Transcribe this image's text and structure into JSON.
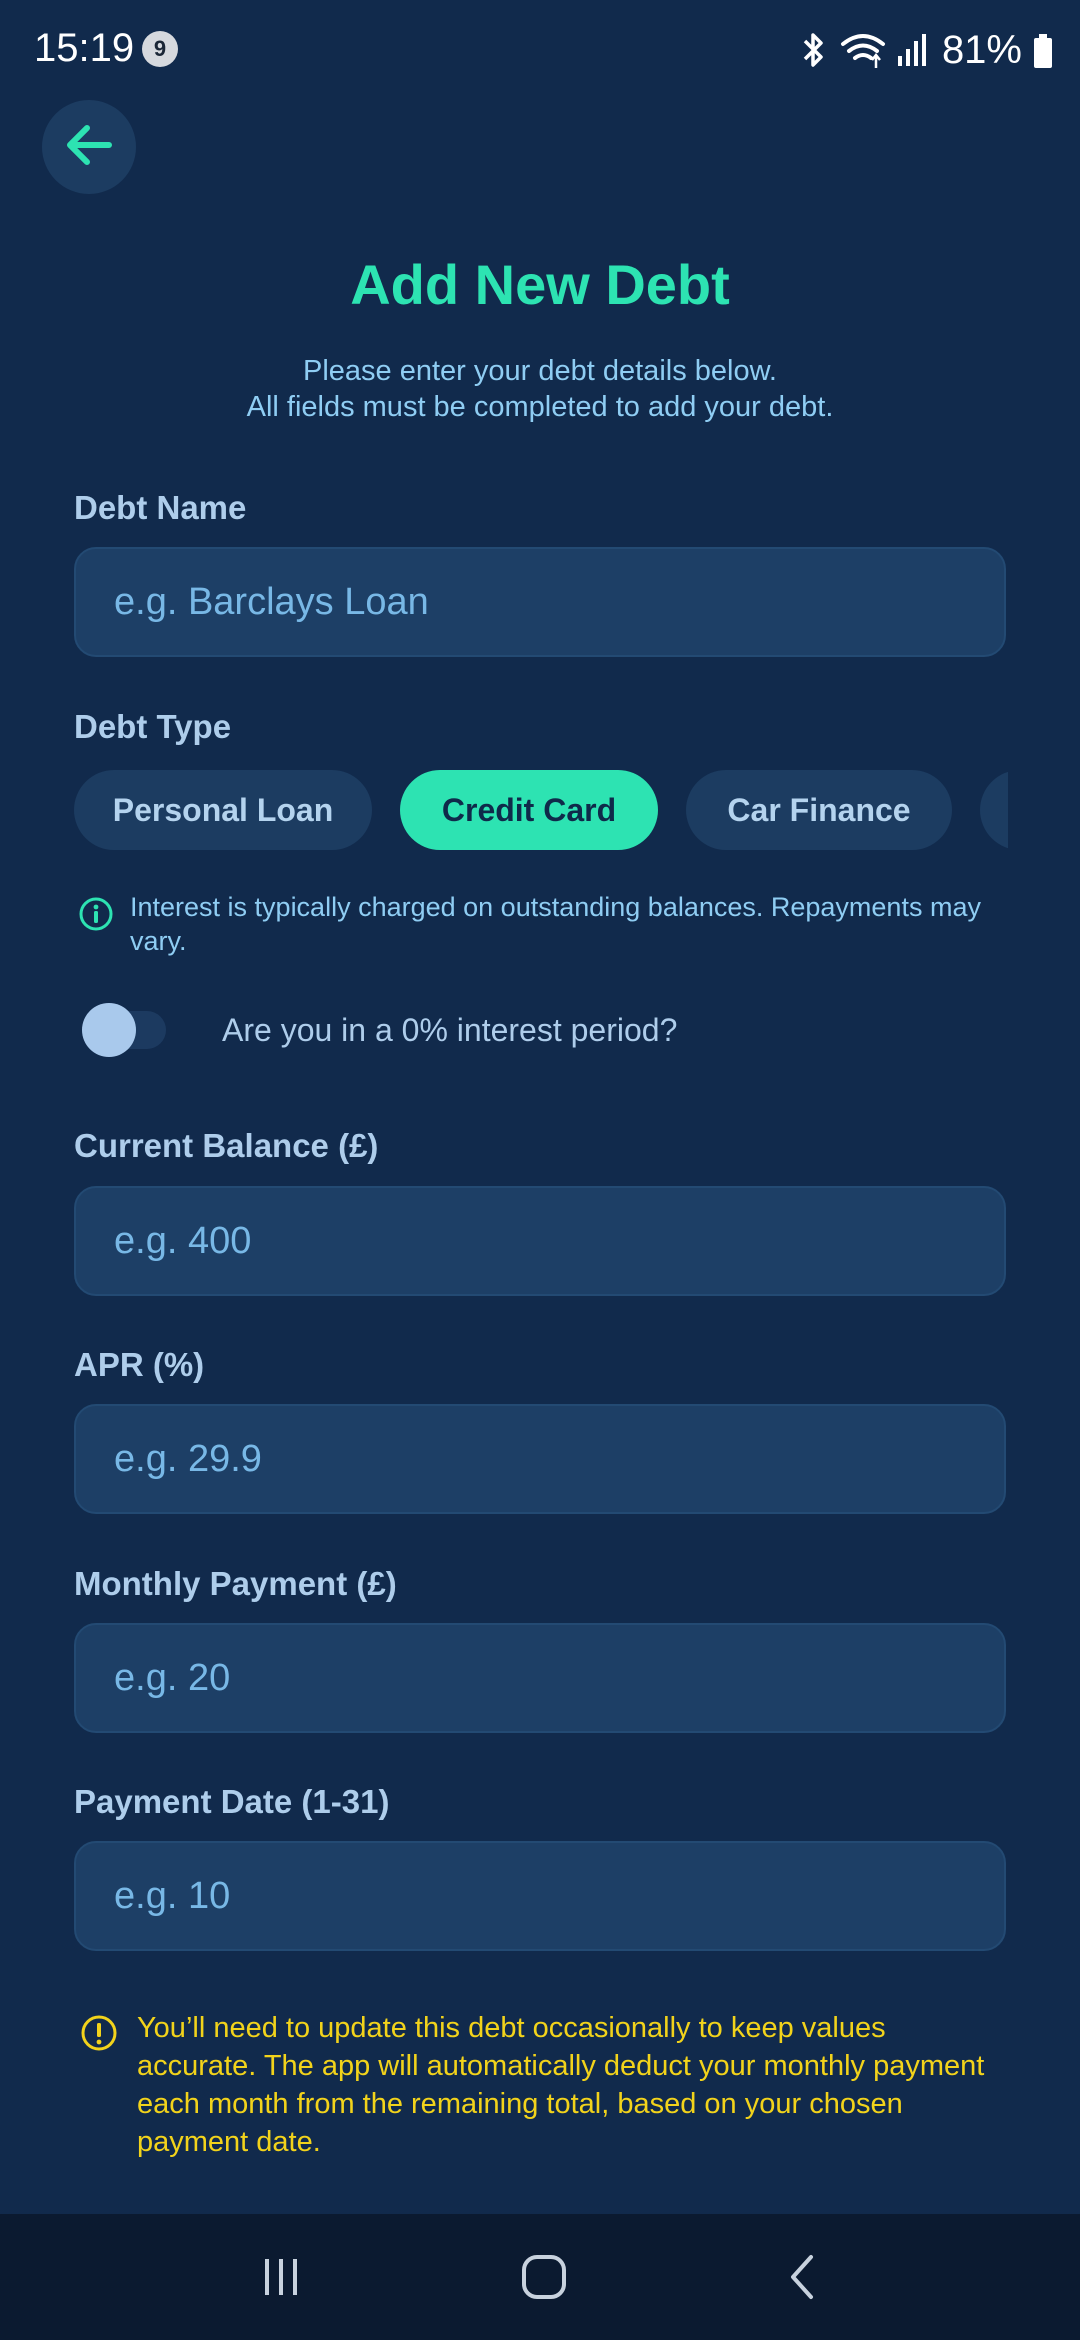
{
  "status_bar": {
    "time": "15:19",
    "notification_count": "9",
    "battery": "81%"
  },
  "header": {
    "title": "Add New Debt",
    "subtitle_line1": "Please enter your debt details below.",
    "subtitle_line2": "All fields must be completed to add your debt."
  },
  "debt_name": {
    "label": "Debt Name",
    "placeholder": "e.g. Barclays Loan"
  },
  "debt_type": {
    "label": "Debt Type",
    "options": [
      "Personal Loan",
      "Credit Card",
      "Car Finance"
    ],
    "selected": "Credit Card",
    "info": "Interest is typically charged on outstanding balances. Repayments may vary."
  },
  "interest_toggle": {
    "label": "Are you in a 0% interest period?",
    "on": false
  },
  "current_balance": {
    "label": "Current Balance (£)",
    "placeholder": "e.g. 400"
  },
  "apr": {
    "label": "APR (%)",
    "placeholder": "e.g. 29.9"
  },
  "monthly_payment": {
    "label": "Monthly Payment (£)",
    "placeholder": "e.g. 20"
  },
  "payment_date": {
    "label": "Payment Date (1-31)",
    "placeholder": "e.g. 10"
  },
  "warning": {
    "text": "You’ll need to update this debt occasionally to keep values accurate. The app will automatically deduct your monthly payment each month from the remaining total, based on your chosen payment date."
  },
  "colors": {
    "background": "#112a4c",
    "accent": "#2de3b2",
    "input_bg": "#1d3f66",
    "warning": "#f2d31b"
  },
  "icons": {
    "back": "arrow-left-icon",
    "info": "info-circle-icon",
    "warning": "exclamation-circle-icon",
    "nav_recent": "recent-apps-icon",
    "nav_home": "home-icon",
    "nav_back": "nav-back-icon"
  }
}
